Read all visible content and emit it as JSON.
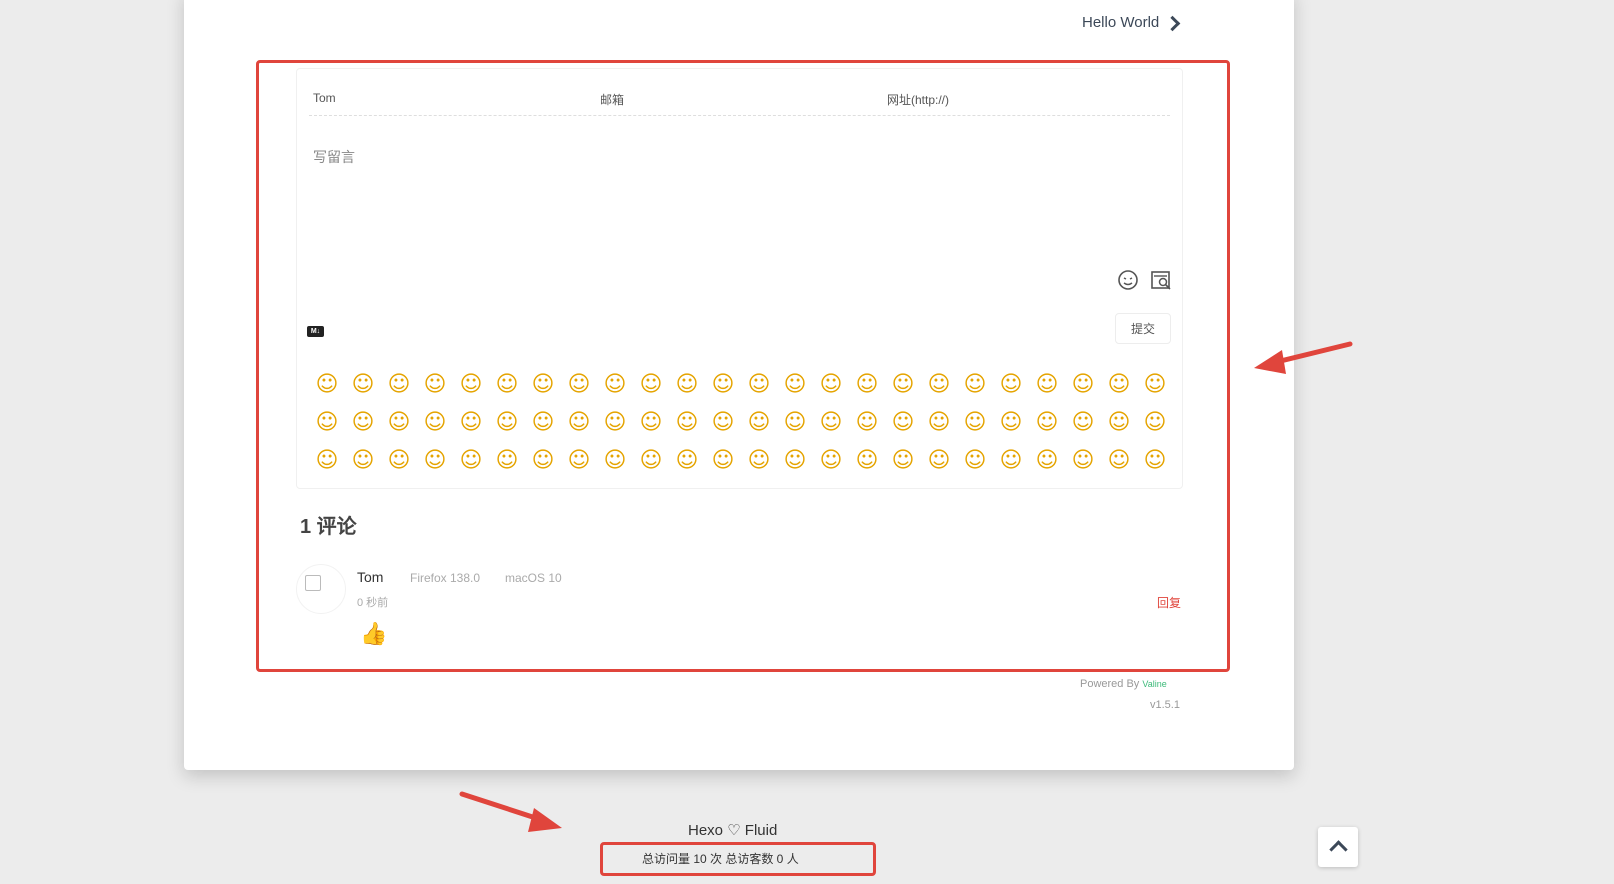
{
  "nav": {
    "next_post": "Hello World"
  },
  "comment_form": {
    "name_value": "Tom",
    "email_placeholder": "邮箱",
    "url_placeholder": "网址(http://)",
    "textarea_placeholder": "写留言",
    "markdown_badge": "M↓",
    "submit_label": "提交",
    "emojis": [
      "☺",
      "☺",
      "☺",
      "☺",
      "☺",
      "☺",
      "☺",
      "☺",
      "☺",
      "☺",
      "☺",
      "☺",
      "☺",
      "☺",
      "☺",
      "☺",
      "☺",
      "☺",
      "☺",
      "☺",
      "☺",
      "☺",
      "☺",
      "☺",
      "☺",
      "☺",
      "☺",
      "☺",
      "☺",
      "☺",
      "☺",
      "☺",
      "☺",
      "☺",
      "☺",
      "☺",
      "☺",
      "☺",
      "☺",
      "☺",
      "☺",
      "☺",
      "☺",
      "☺",
      "☺",
      "☺",
      "☺",
      "☺",
      "☺",
      "☺",
      "☺",
      "☺",
      "☺",
      "☺",
      "☺",
      "☺",
      "☺",
      "☺",
      "☺",
      "☺",
      "☺",
      "☺",
      "☺",
      "☺",
      "☺",
      "☺",
      "☺",
      "☺",
      "☺",
      "☺",
      "☺",
      "☺"
    ]
  },
  "comments": {
    "count_title": "1 评论",
    "items": [
      {
        "author": "Tom",
        "browser": "Firefox 138.0",
        "os": "macOS 10",
        "time": "0 秒前",
        "content": "👍",
        "reply_label": "回复"
      }
    ]
  },
  "powered": {
    "prefix": "Powered By",
    "brand": "Valine",
    "version": "v1.5.1"
  },
  "footer": {
    "brand": "Hexo ♡ Fluid",
    "stats": "总访问量 10 次  总访客数 0 人"
  }
}
